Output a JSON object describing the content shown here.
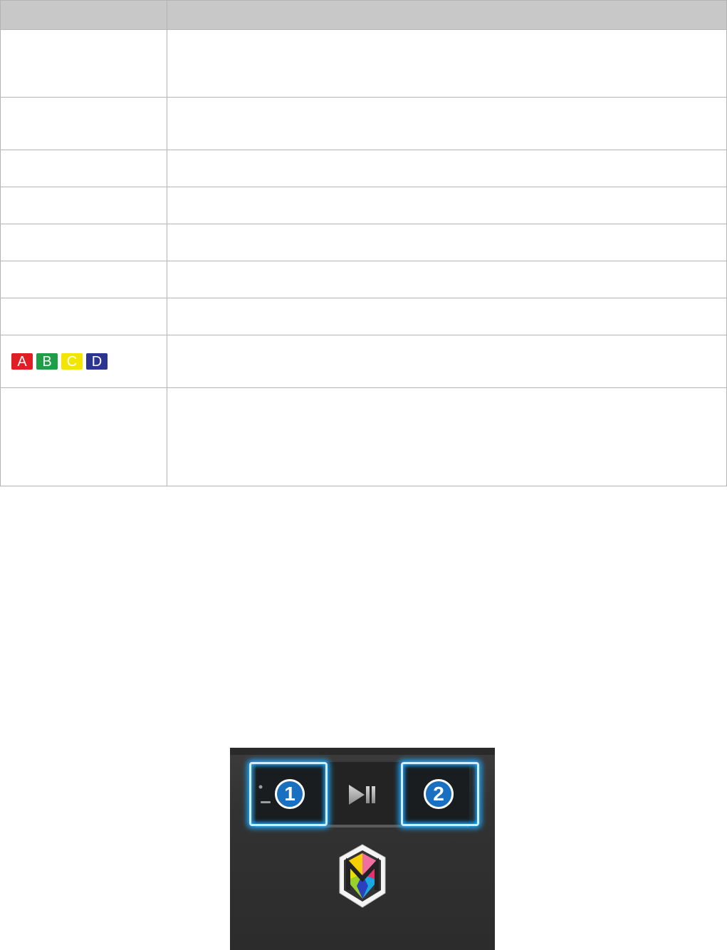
{
  "color_keys": [
    {
      "label": "A",
      "color": "#e01e26"
    },
    {
      "label": "B",
      "color": "#1f9e48"
    },
    {
      "label": "C",
      "color": "#f2e600"
    },
    {
      "label": "D",
      "color": "#2b3590"
    }
  ],
  "badges": [
    "1",
    "2"
  ],
  "icons": {
    "play_pause": "play-pause-icon",
    "smart_hub": "smart-hub-icon"
  }
}
